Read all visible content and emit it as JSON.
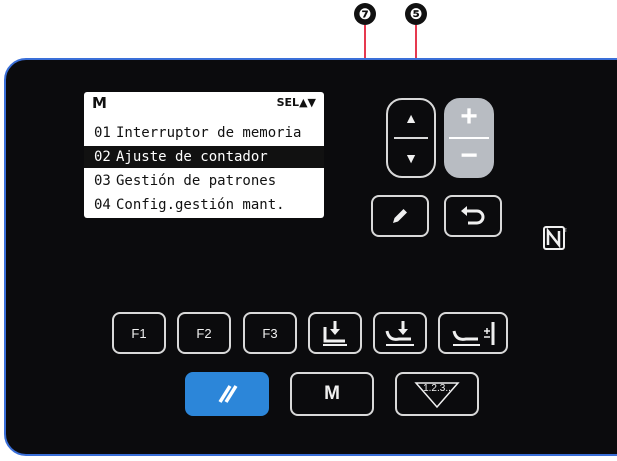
{
  "callouts": {
    "pencil": "❼",
    "updown": "❺"
  },
  "lcd": {
    "mode": "M",
    "sel_indicator": "SEL▲▼",
    "rows": [
      {
        "num": "01",
        "text": "Interruptor de memoria",
        "selected": false
      },
      {
        "num": "02",
        "text": "Ajuste de contador",
        "selected": true
      },
      {
        "num": "03",
        "text": "Gestión de patrones",
        "selected": false
      },
      {
        "num": "04",
        "text": "Config.gestión mant.",
        "selected": false
      }
    ]
  },
  "buttons": {
    "f1": "F1",
    "f2": "F2",
    "f3": "F3",
    "m": "M",
    "counter": "1.2.3..",
    "plus": "+",
    "minus": "−",
    "up": "▲",
    "down": "▼"
  },
  "icons": {
    "pencil": "pencil-icon",
    "return": "return-icon",
    "nfc": "nfc-icon",
    "reset": "reset-icon",
    "presser_foot": "presser-foot-icon",
    "thread_clamp": "thread-clamp-icon",
    "bobbin_winder": "bobbin-winder-icon"
  },
  "colors": {
    "panel_border": "#3a6fd8",
    "reset_button": "#2c86d9",
    "plusminus": "#b8bcc2"
  }
}
